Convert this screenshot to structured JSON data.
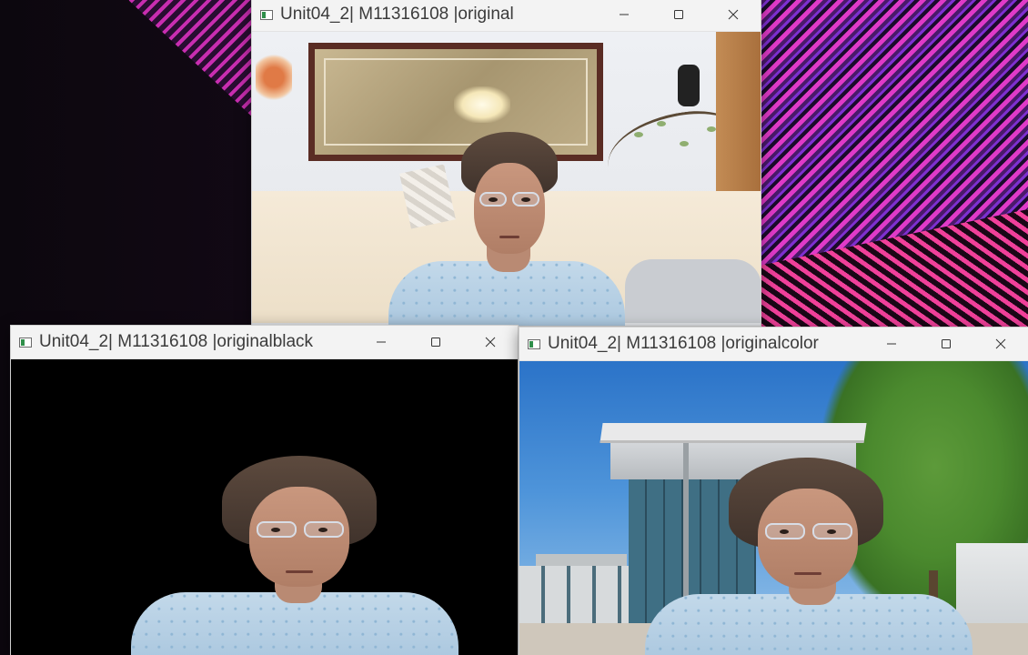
{
  "desktop": {
    "wallpaper": "dark magenta diagonal stripes"
  },
  "windows": [
    {
      "id": "original",
      "title": "Unit04_2| M11316108 |original",
      "controls": [
        "minimize",
        "maximize",
        "close"
      ]
    },
    {
      "id": "originalblack",
      "title": "Unit04_2| M11316108 |originalblack",
      "controls": [
        "minimize",
        "maximize",
        "close"
      ]
    },
    {
      "id": "originalcolor",
      "title": "Unit04_2| M11316108 |originalcolor",
      "controls": [
        "minimize",
        "maximize",
        "close"
      ]
    }
  ],
  "colors": {
    "titlebar": "#f3f3f3",
    "stripe_accent": "#e03ac8",
    "sky": "#2b73c8"
  }
}
